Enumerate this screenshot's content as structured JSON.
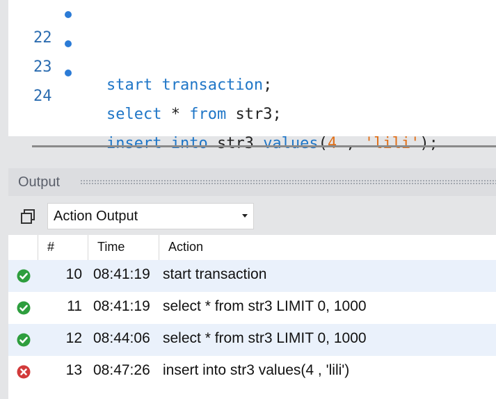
{
  "editor": {
    "lines": [
      {
        "number": "22",
        "tokens": [
          {
            "t": "start transaction",
            "c": "kw"
          },
          {
            "t": ";",
            "c": "plain"
          }
        ]
      },
      {
        "number": "23",
        "tokens": [
          {
            "t": "select",
            "c": "kw"
          },
          {
            "t": " * ",
            "c": "plain"
          },
          {
            "t": "from",
            "c": "kw"
          },
          {
            "t": " str3;",
            "c": "plain"
          }
        ]
      },
      {
        "number": "24",
        "tokens": [
          {
            "t": "insert into",
            "c": "kw"
          },
          {
            "t": " str3 ",
            "c": "plain"
          },
          {
            "t": "values",
            "c": "kw"
          },
          {
            "t": "(",
            "c": "plain"
          },
          {
            "t": "4",
            "c": "num"
          },
          {
            "t": " , ",
            "c": "plain"
          },
          {
            "t": "'lili'",
            "c": "str"
          },
          {
            "t": ");",
            "c": "plain"
          }
        ]
      }
    ]
  },
  "output": {
    "title": "Output",
    "selector_value": "Action Output",
    "columns": [
      "#",
      "Time",
      "Action"
    ],
    "rows": [
      {
        "status": "success",
        "num": "10",
        "time": "08:41:19",
        "action": "start transaction"
      },
      {
        "status": "success",
        "num": "11",
        "time": "08:41:19",
        "action": "select * from str3 LIMIT 0, 1000"
      },
      {
        "status": "success",
        "num": "12",
        "time": "08:44:06",
        "action": "select * from str3 LIMIT 0, 1000"
      },
      {
        "status": "error",
        "num": "13",
        "time": "08:47:26",
        "action": "insert into str3 values(4 , 'lili')"
      }
    ]
  },
  "colors": {
    "keyword": "#1f76c7",
    "literal": "#e0701a",
    "success": "#2e9e3e",
    "error": "#d23a3a",
    "row_alt": "#eaf1fb"
  },
  "icons": {
    "breakpoint": "dot-icon",
    "copy": "copy-icon",
    "success": "check-circle-icon",
    "error": "x-circle-icon"
  }
}
